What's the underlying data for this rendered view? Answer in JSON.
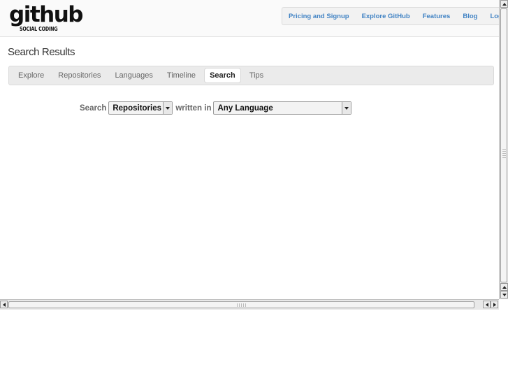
{
  "logo": {
    "main": "github",
    "sub": "SOCIAL CODING"
  },
  "topnav": {
    "items": [
      {
        "label": "Pricing and Signup"
      },
      {
        "label": "Explore GitHub"
      },
      {
        "label": "Features"
      },
      {
        "label": "Blog"
      },
      {
        "label": "Login"
      }
    ],
    "color": "#4183c4"
  },
  "page": {
    "title": "Search Results"
  },
  "subnav": {
    "items": [
      {
        "label": "Explore"
      },
      {
        "label": "Repositories"
      },
      {
        "label": "Languages"
      },
      {
        "label": "Timeline"
      },
      {
        "label": "Search",
        "active": true
      },
      {
        "label": "Tips"
      }
    ]
  },
  "search": {
    "search_label": "Search",
    "type_selected": "Repositories",
    "written_in_label": "written in",
    "language_selected": "Any Language"
  }
}
